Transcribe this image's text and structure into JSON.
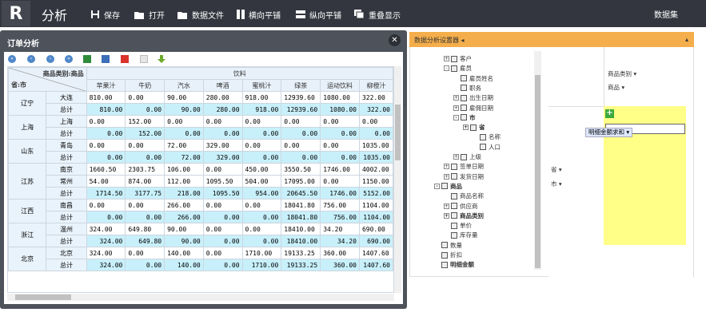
{
  "topbar": {
    "app_title": "分析",
    "buttons": [
      "保存",
      "打开",
      "数据文件",
      "横向平铺",
      "纵向平铺",
      "重叠显示"
    ],
    "dataset_label": "数据集"
  },
  "dialog": {
    "title": "订单分析",
    "close": "✕",
    "pivot": {
      "corner_col_label": "商品类别:商品",
      "corner_row_label": "省:市",
      "category": "饮料",
      "columns": [
        "苹果汁",
        "牛奶",
        "汽水",
        "啤酒",
        "蜜桃汁",
        "绿茶",
        "运动饮料",
        "柳橙汁"
      ],
      "groups": [
        {
          "province": "辽宁",
          "rows": [
            {
              "city": "大连",
              "values": [
                "810.00",
                "0.00",
                "90.00",
                "280.00",
                "918.00",
                "12939.60",
                "1080.00",
                "322.00"
              ]
            },
            {
              "city": "总计",
              "values": [
                "810.00",
                "0.00",
                "90.00",
                "280.00",
                "918.00",
                "12939.60",
                "1080.00",
                "322.00"
              ],
              "total": true
            }
          ]
        },
        {
          "province": "上海",
          "rows": [
            {
              "city": "上海",
              "values": [
                "0.00",
                "152.00",
                "0.00",
                "0.00",
                "0.00",
                "0.00",
                "0.00",
                "0.00"
              ]
            },
            {
              "city": "总计",
              "values": [
                "0.00",
                "152.00",
                "0.00",
                "0.00",
                "0.00",
                "0.00",
                "0.00",
                "0.00"
              ],
              "total": true
            }
          ]
        },
        {
          "province": "山东",
          "rows": [
            {
              "city": "青岛",
              "values": [
                "0.00",
                "0.00",
                "72.00",
                "329.00",
                "0.00",
                "0.00",
                "0.00",
                "1035.00"
              ]
            },
            {
              "city": "总计",
              "values": [
                "0.00",
                "0.00",
                "72.00",
                "329.00",
                "0.00",
                "0.00",
                "0.00",
                "1035.00"
              ],
              "total": true
            }
          ]
        },
        {
          "province": "江苏",
          "rows": [
            {
              "city": "南京",
              "values": [
                "1660.50",
                "2303.75",
                "106.00",
                "0.00",
                "450.00",
                "3550.50",
                "1746.00",
                "4002.00"
              ]
            },
            {
              "city": "常州",
              "values": [
                "54.00",
                "874.00",
                "112.00",
                "1095.50",
                "504.00",
                "17095.00",
                "0.00",
                "1150.00"
              ]
            },
            {
              "city": "总计",
              "values": [
                "1714.50",
                "3177.75",
                "218.00",
                "1095.50",
                "954.00",
                "20645.50",
                "1746.00",
                "5152.00"
              ],
              "total": true
            }
          ]
        },
        {
          "province": "江西",
          "rows": [
            {
              "city": "南昌",
              "values": [
                "0.00",
                "0.00",
                "266.00",
                "0.00",
                "0.00",
                "18041.80",
                "756.00",
                "1104.00"
              ]
            },
            {
              "city": "总计",
              "values": [
                "0.00",
                "0.00",
                "266.00",
                "0.00",
                "0.00",
                "18041.80",
                "756.00",
                "1104.00"
              ],
              "total": true
            }
          ]
        },
        {
          "province": "浙江",
          "rows": [
            {
              "city": "温州",
              "values": [
                "324.00",
                "649.80",
                "90.00",
                "0.00",
                "0.00",
                "18410.00",
                "34.20",
                "690.00"
              ]
            },
            {
              "city": "总计",
              "values": [
                "324.00",
                "649.80",
                "90.00",
                "0.00",
                "0.00",
                "18410.00",
                "34.20",
                "690.00"
              ],
              "total": true
            }
          ]
        },
        {
          "province": "北京",
          "rows": [
            {
              "city": "北京",
              "values": [
                "324.00",
                "0.00",
                "140.00",
                "0.00",
                "1710.00",
                "19133.25",
                "360.00",
                "1407.60"
              ]
            },
            {
              "city": "总计",
              "values": [
                "324.00",
                "0.00",
                "140.00",
                "0.00",
                "1710.00",
                "19133.25",
                "360.00",
                "1407.60"
              ],
              "total": true
            }
          ]
        }
      ]
    }
  },
  "settings_panel": {
    "title": "数据分析设置器",
    "tree": [
      {
        "label": "客户",
        "level": 1,
        "expander": "+"
      },
      {
        "label": "雇员",
        "level": 1,
        "expander": "-"
      },
      {
        "label": "雇员姓名",
        "level": 2,
        "expander": ""
      },
      {
        "label": "职务",
        "level": 2,
        "expander": ""
      },
      {
        "label": "出生日期",
        "level": 2,
        "expander": "+"
      },
      {
        "label": "雇佣日期",
        "level": 2,
        "expander": "+"
      },
      {
        "label": "市",
        "level": 2,
        "expander": "-",
        "bold": true
      },
      {
        "label": "省",
        "level": 3,
        "expander": "+",
        "bold": true
      },
      {
        "label": "名称",
        "level": 4,
        "expander": ""
      },
      {
        "label": "人口",
        "level": 4,
        "expander": ""
      },
      {
        "label": "上级",
        "level": 2,
        "expander": "+"
      },
      {
        "label": "签单日期",
        "level": 1,
        "expander": "+"
      },
      {
        "label": "发货日期",
        "level": 1,
        "expander": "+"
      },
      {
        "label": "商品",
        "level": 0,
        "expander": "-",
        "bold": true
      },
      {
        "label": "商品名称",
        "level": 1,
        "expander": ""
      },
      {
        "label": "供应商",
        "level": 1,
        "expander": "+"
      },
      {
        "label": "商品类别",
        "level": 1,
        "expander": "+",
        "bold": true
      },
      {
        "label": "单价",
        "level": 1,
        "expander": ""
      },
      {
        "label": "库存量",
        "level": 1,
        "expander": ""
      },
      {
        "label": "数量",
        "level": 0,
        "expander": ""
      },
      {
        "label": "折扣",
        "level": 0,
        "expander": ""
      },
      {
        "label": "明细金额",
        "level": 0,
        "expander": "",
        "bold": true
      }
    ],
    "col_fields": [
      "商品类别",
      "商品"
    ],
    "row_fields": [
      "省",
      "市"
    ],
    "measure": "明细金额求和",
    "add_label": "+"
  }
}
